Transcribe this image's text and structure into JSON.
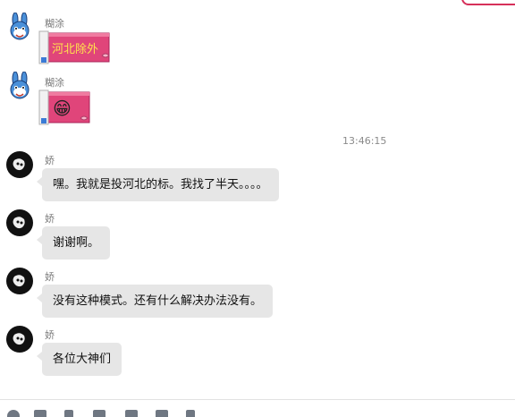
{
  "messages": [
    {
      "sender": "糊涂",
      "type": "gift",
      "gift_text": "河北除外",
      "avatar_icon": "rabbit-avatar-icon"
    },
    {
      "sender": "糊涂",
      "type": "gift-emoji",
      "emoji": "😁",
      "avatar_icon": "rabbit-avatar-icon"
    },
    {
      "sender": "娇",
      "type": "text",
      "text": "嘿。我就是投河北的标。我找了半天。。。。",
      "avatar_icon": "dark-avatar-icon"
    },
    {
      "sender": "娇",
      "type": "text",
      "text": "谢谢啊。",
      "avatar_icon": "dark-avatar-icon"
    },
    {
      "sender": "娇",
      "type": "text",
      "text": "没有这种模式。还有什么解决办法没有。",
      "avatar_icon": "dark-avatar-icon"
    },
    {
      "sender": "娇",
      "type": "text",
      "text": "各位大神们",
      "avatar_icon": "dark-avatar-icon"
    }
  ],
  "timestamp": "13:46:15",
  "toolbar": {
    "icons": [
      "emoji-icon",
      "folder-icon",
      "scissors-icon",
      "file-icon",
      "doc-icon",
      "image-icon",
      "send-icon"
    ]
  },
  "colors": {
    "accent": "#d6305a",
    "gift_box": "#e0457a",
    "bubble": "#e6e6e6"
  }
}
